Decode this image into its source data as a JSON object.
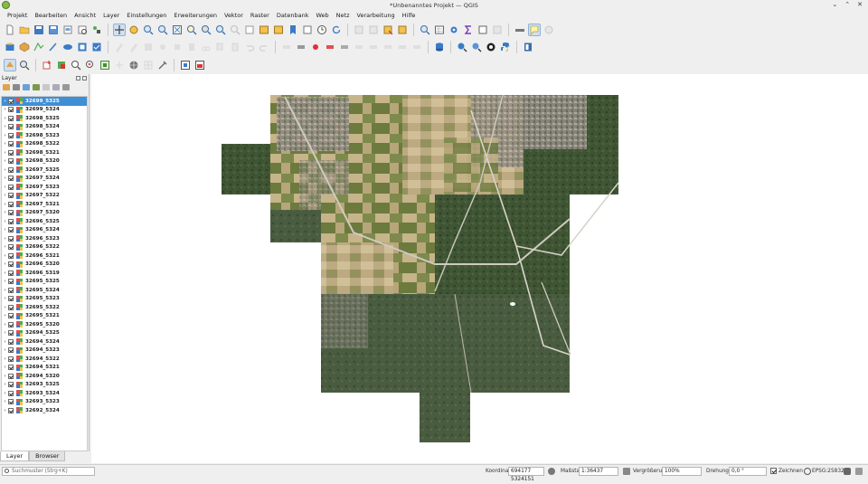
{
  "window": {
    "title": "*Unbenanntes Projekt — QGIS",
    "controls": [
      "⌄",
      "⌃",
      "✕"
    ]
  },
  "menu": [
    "Projekt",
    "Bearbeiten",
    "Ansicht",
    "Layer",
    "Einstellungen",
    "Erweiterungen",
    "Vektor",
    "Raster",
    "Datenbank",
    "Web",
    "Netz",
    "Verarbeitung",
    "Hilfe"
  ],
  "layer_panel": {
    "title": "Layer",
    "layers": [
      "32699_5325",
      "32699_5324",
      "32698_5325",
      "32698_5324",
      "32698_5323",
      "32698_5322",
      "32698_5321",
      "32698_5320",
      "32697_5325",
      "32697_5324",
      "32697_5323",
      "32697_5322",
      "32697_5321",
      "32697_5320",
      "32696_5325",
      "32696_5324",
      "32696_5323",
      "32696_5322",
      "32696_5321",
      "32696_5320",
      "32696_5319",
      "32695_5325",
      "32695_5324",
      "32695_5323",
      "32695_5322",
      "32695_5321",
      "32695_5320",
      "32694_5325",
      "32694_5324",
      "32694_5323",
      "32694_5322",
      "32694_5321",
      "32694_5320",
      "32693_5325",
      "32693_5324",
      "32693_5323",
      "32692_5324"
    ],
    "selected_layer": "32699_5325",
    "tabs": [
      "Layer",
      "Browser"
    ],
    "active_tab": "Layer"
  },
  "statusbar": {
    "search_placeholder": "Suchmuster (Strg+K)",
    "coord_label": "Koordinate",
    "coord_value": "694177 5324151",
    "scale_label": "Maßstab",
    "scale_value": "1:36437",
    "magnifier_label": "Vergrößerung",
    "magnifier_value": "100%",
    "rotation_label": "Drehung",
    "rotation_value": "0,0 °",
    "render_label": "Zeichnen",
    "crs_label": "EPSG:25832"
  },
  "colors": {
    "selection": "#3f8fd6",
    "forest": "#3d5531",
    "field_light": "#b7a57c",
    "field_green": "#6f7f43",
    "urban": "#8d8a84"
  }
}
